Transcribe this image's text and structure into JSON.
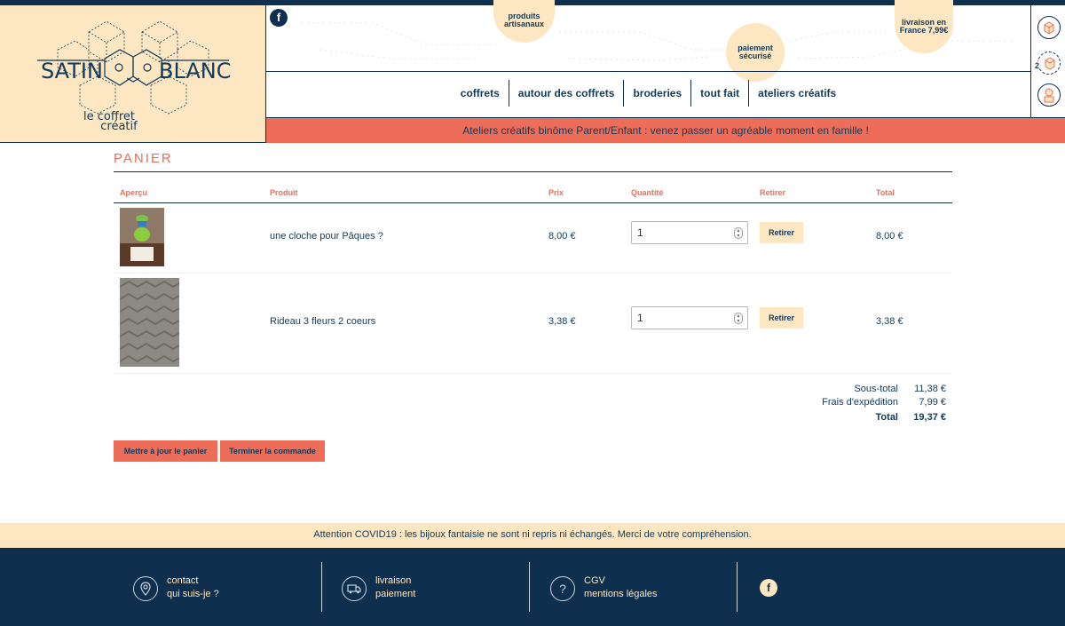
{
  "logo": {
    "name_left": "SATIN",
    "name_right": "BLANC",
    "tagline_1": "le coffret",
    "tagline_2": "créatif"
  },
  "header": {
    "badges": [
      {
        "text": "produits artisanaux"
      },
      {
        "text": "paiement sécurisé"
      },
      {
        "text": "livraison en France 7,99€"
      }
    ],
    "nav": [
      "coffrets",
      "autour des coffrets",
      "broderies",
      "tout fait",
      "ateliers créatifs"
    ],
    "cart_count": "2",
    "announcement": "Ateliers créatifs binôme Parent/Enfant : venez passer un agréable moment en famille !"
  },
  "cart": {
    "title": "PANIER",
    "columns": [
      "Aperçu",
      "Produit",
      "Prix",
      "Quantité",
      "Retirer",
      "Total"
    ],
    "rows": [
      {
        "product": "une cloche pour Pâques ?",
        "price": "8,00 €",
        "quantity": "1",
        "remove_label": "Retirer",
        "total": "8,00 €"
      },
      {
        "product": "Rideau 3 fleurs 2 coeurs",
        "price": "3,38 €",
        "quantity": "1",
        "remove_label": "Retirer",
        "total": "3,38 €"
      }
    ],
    "subtotal_label": "Sous-total",
    "subtotal": "11,38 €",
    "shipping_label": "Frais d'expédition",
    "shipping": "7,99 €",
    "total_label": "Total",
    "total": "19,37 €",
    "update_button": "Mettre à jour le panier",
    "checkout_button": "Terminer la commande"
  },
  "footer": {
    "covid_notice": "Attention COVID19 : les bijoux fantaisie ne sont ni repris ni échangés. Merci de votre compréhension.",
    "col1": [
      "contact",
      "qui suis-je ?"
    ],
    "col2": [
      "livraison",
      "paiement"
    ],
    "col3": [
      "CGV",
      "mentions légales"
    ]
  },
  "icons": {
    "facebook": "f",
    "location": "location-pin-icon",
    "truck": "truck-icon",
    "question": "question-icon"
  },
  "colors": {
    "navy": "#0f2f4f",
    "cream": "#fde6c2",
    "coral": "#ee6d58"
  }
}
